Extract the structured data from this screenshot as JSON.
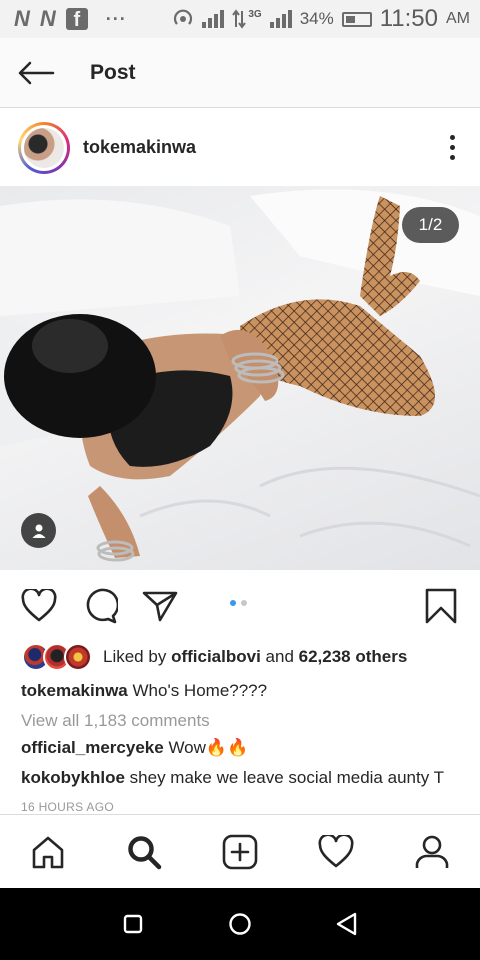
{
  "status_bar": {
    "left_icons": [
      "N",
      "N",
      "f"
    ],
    "dots": "···",
    "network": "3G",
    "battery": "34%",
    "time": "11:50",
    "ampm": "AM"
  },
  "nav": {
    "title": "Post",
    "back_icon": "arrow-left-icon"
  },
  "post": {
    "username": "tokemakinwa",
    "image_counter": "1/2",
    "likes": {
      "prefix": "Liked by",
      "by_user": "officialbovi",
      "middle": "and",
      "others": "62,238 others"
    },
    "caption": {
      "user": "tokemakinwa",
      "text": "Who's Home????"
    },
    "view_all_comments": "View all 1,183 comments",
    "comments": [
      {
        "user": "official_mercyeke",
        "text": "Wow🔥🔥"
      },
      {
        "user": "kokobykhloe",
        "text": "shey make we leave social media aunty T"
      }
    ],
    "time_ago": "16 HOURS AGO",
    "carousel": {
      "count": 2,
      "active": 1
    }
  },
  "tabs": [
    {
      "name": "home",
      "icon": "home-icon"
    },
    {
      "name": "search",
      "icon": "search-icon",
      "active": true
    },
    {
      "name": "new-post",
      "icon": "add-post-icon"
    },
    {
      "name": "activity",
      "icon": "heart-icon"
    },
    {
      "name": "profile",
      "icon": "profile-icon"
    }
  ],
  "colors": {
    "text": "#262626",
    "muted": "#999999",
    "accent_dot": "#3897f0",
    "divider": "#dbdbdb"
  }
}
